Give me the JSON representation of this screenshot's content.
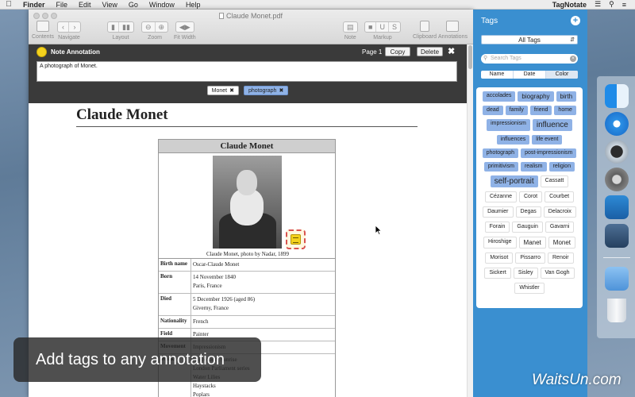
{
  "menubar": {
    "apple_icon": "apple-icon",
    "items": [
      "Finder",
      "File",
      "Edit",
      "View",
      "Go",
      "Window",
      "Help"
    ],
    "right_app": "TagNotate"
  },
  "window": {
    "title": "Claude Monet.pdf",
    "toolbar": {
      "contents": "Contents",
      "navigate": "Navigate",
      "layout": "Layout",
      "zoom": "Zoom",
      "fit_width": "Fit Width",
      "note": "Note",
      "markup": "Markup",
      "clipboard": "Clipboard",
      "annotations": "Annotations"
    }
  },
  "annotation": {
    "title": "Note Annotation",
    "page": "Page 1",
    "copy": "Copy",
    "delete": "Delete",
    "text": "A photograph of Monet.",
    "tags": [
      "Monet",
      "photograph"
    ]
  },
  "document": {
    "title": "Claude Monet",
    "infobox": {
      "header": "Claude Monet",
      "caption": "Claude Monet, photo by Nadar, 1899",
      "rows": [
        {
          "key": "Birth name",
          "value": [
            "Oscar-Claude Monet"
          ]
        },
        {
          "key": "Born",
          "value": [
            "14 November 1840",
            "Paris, France"
          ]
        },
        {
          "key": "Died",
          "value": [
            "5 December 1926 (aged 86)",
            "Giverny, France"
          ]
        },
        {
          "key": "Nationality",
          "value": [
            "French"
          ]
        },
        {
          "key": "Field",
          "value": [
            "Painter"
          ]
        },
        {
          "key": "Movement",
          "value": [
            "Impressionism"
          ]
        },
        {
          "key": "Works",
          "value": [
            "Impression, Sunrise",
            "London Parliament series",
            "Water Lilies",
            "Haystacks",
            "Poplars"
          ]
        }
      ]
    }
  },
  "banner": "Add tags to any annotation",
  "tags_panel": {
    "title": "Tags",
    "filter": "All Tags",
    "search_placeholder": "Search Tags",
    "sort": [
      "Name",
      "Date",
      "Color"
    ],
    "sort_selected": "Color",
    "tags": [
      {
        "label": "accolades",
        "style": "blue"
      },
      {
        "label": "biography",
        "style": "blue mid"
      },
      {
        "label": "birth",
        "style": "blue mid"
      },
      {
        "label": "dead",
        "style": "blue"
      },
      {
        "label": "family",
        "style": "blue"
      },
      {
        "label": "friend",
        "style": "blue"
      },
      {
        "label": "home",
        "style": "blue"
      },
      {
        "label": "impressionism",
        "style": "blue"
      },
      {
        "label": "influence",
        "style": "blue big"
      },
      {
        "label": "influences",
        "style": "blue"
      },
      {
        "label": "life event",
        "style": "blue"
      },
      {
        "label": "photograph",
        "style": "blue"
      },
      {
        "label": "post-impressionism",
        "style": "blue"
      },
      {
        "label": "primitivism",
        "style": "blue"
      },
      {
        "label": "realism",
        "style": "blue"
      },
      {
        "label": "religion",
        "style": "blue"
      },
      {
        "label": "self-portrait",
        "style": "blue big"
      },
      {
        "label": "Cassatt",
        "style": "white"
      },
      {
        "label": "Cézanne",
        "style": "white"
      },
      {
        "label": "Corot",
        "style": "white"
      },
      {
        "label": "Courbet",
        "style": "white"
      },
      {
        "label": "Daumier",
        "style": "white"
      },
      {
        "label": "Degas",
        "style": "white"
      },
      {
        "label": "Delacroix",
        "style": "white"
      },
      {
        "label": "Forain",
        "style": "white"
      },
      {
        "label": "Gauguin",
        "style": "white"
      },
      {
        "label": "Gavarni",
        "style": "white"
      },
      {
        "label": "Hiroshige",
        "style": "white"
      },
      {
        "label": "Manet",
        "style": "white mid"
      },
      {
        "label": "Monet",
        "style": "white mid"
      },
      {
        "label": "Morisot",
        "style": "white"
      },
      {
        "label": "Pissarro",
        "style": "white"
      },
      {
        "label": "Renoir",
        "style": "white"
      },
      {
        "label": "Sickert",
        "style": "white"
      },
      {
        "label": "Sisley",
        "style": "white"
      },
      {
        "label": "Van Gogh",
        "style": "white"
      },
      {
        "label": "Whistler",
        "style": "white"
      }
    ]
  },
  "dock": {
    "items": [
      "finder-icon",
      "safari-icon",
      "quicktime-icon",
      "system-preferences-icon",
      "preview-icon",
      "screen-sharing-icon",
      "applications-folder-icon",
      "trash-icon"
    ]
  },
  "watermark": "WaitsUn.com",
  "colors": {
    "panel_blue": "#3a8fd0",
    "tag_blue": "#8fb2e6",
    "annotation_bar": "#3a3a3a",
    "note_yellow": "#f4d21d"
  }
}
